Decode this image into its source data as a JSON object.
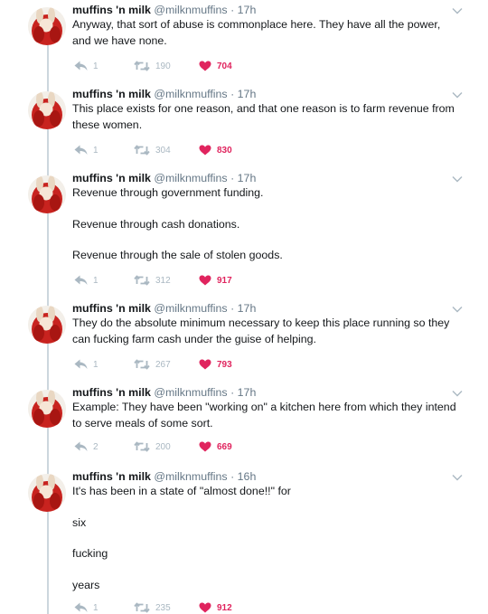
{
  "account": {
    "name": "muffins 'n milk",
    "handle": "@milknmuffins",
    "separator": "·"
  },
  "colors": {
    "like": "#e0245e",
    "icon_gray": "#aab8c2",
    "thread_line": "#ccd6dd",
    "text_secondary": "#657786"
  },
  "icons": {
    "reply": "reply-icon",
    "retweet": "retweet-icon",
    "like": "heart-icon",
    "menu": "chevron-down-icon"
  },
  "tweets": [
    {
      "time": "17h",
      "paragraphs": [
        "Anyway, that sort of abuse is commonplace here. They have all the power, and we have none."
      ],
      "replies": "1",
      "retweets": "190",
      "likes": "704"
    },
    {
      "time": "17h",
      "paragraphs": [
        "This place exists for one reason, and that one reason is to farm revenue from these women."
      ],
      "replies": "1",
      "retweets": "304",
      "likes": "830"
    },
    {
      "time": "17h",
      "paragraphs": [
        "Revenue through government funding.",
        "Revenue through cash donations.",
        "Revenue through the sale of stolen goods."
      ],
      "replies": "1",
      "retweets": "312",
      "likes": "917"
    },
    {
      "time": "17h",
      "paragraphs": [
        "They do the absolute minimum necessary to keep this place running so they can fucking farm cash under the guise of helping."
      ],
      "replies": "1",
      "retweets": "267",
      "likes": "793"
    },
    {
      "time": "17h",
      "paragraphs": [
        "Example: They have been \"working on\" a kitchen here from which they intend to serve meals of some sort."
      ],
      "replies": "2",
      "retweets": "200",
      "likes": "669"
    },
    {
      "time": "16h",
      "paragraphs": [
        "It's has been in a state of \"almost done!!\" for",
        "six",
        "fucking",
        "years"
      ],
      "replies": "1",
      "retweets": "235",
      "likes": "912"
    }
  ]
}
